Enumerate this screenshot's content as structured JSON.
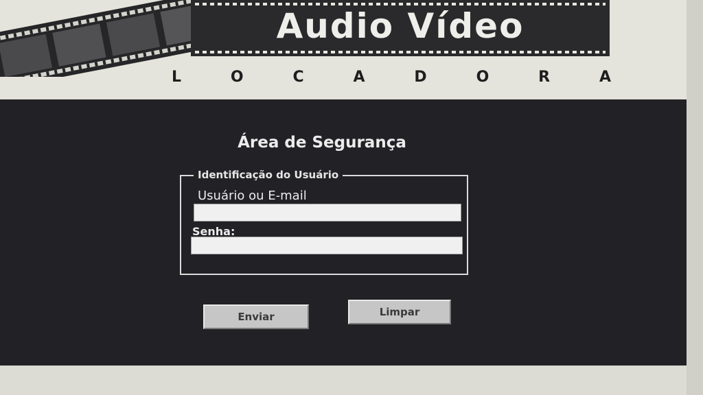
{
  "logo": {
    "title": "Audio Vídeo",
    "subtitle_letters": [
      "L",
      "O",
      "C",
      "A",
      "D",
      "O",
      "R",
      "A"
    ]
  },
  "login": {
    "page_title": "Área de Segurança",
    "fieldset_legend": "Identificação do Usuário",
    "user_label": "Usuário ou E-mail",
    "user_value": "",
    "password_label": "Senha:",
    "password_value": "",
    "send_label": "Enviar",
    "clear_label": "Limpar"
  },
  "colors": {
    "panel_background": "#222226",
    "page_background": "#e4e4dc",
    "button_face": "#c6c6c6"
  }
}
